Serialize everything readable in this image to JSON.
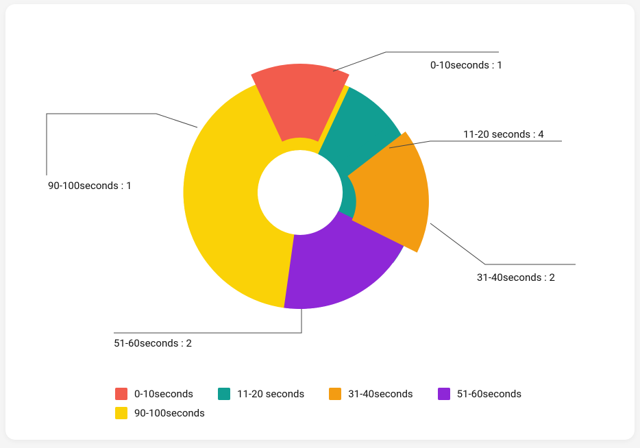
{
  "chart_data": {
    "type": "pie",
    "title": "",
    "inner_radius": 0.35,
    "series": [
      {
        "name": "0-10seconds",
        "value": 1,
        "color": "#F25C4D",
        "exploded": true
      },
      {
        "name": "11-20 seconds",
        "value": 4,
        "color": "#119E92",
        "exploded": false
      },
      {
        "name": "31-40seconds",
        "value": 2,
        "color": "#F39C12",
        "exploded": true
      },
      {
        "name": "51-60seconds",
        "value": 2,
        "color": "#8E27D7",
        "exploded": false
      },
      {
        "name": "90-100seconds",
        "value": 1,
        "color": "#FAD207",
        "exploded": false
      }
    ],
    "label_separator": " : "
  },
  "legend": {
    "items": [
      {
        "label": "0-10seconds",
        "color": "#F25C4D"
      },
      {
        "label": "11-20 seconds",
        "color": "#119E92"
      },
      {
        "label": "31-40seconds",
        "color": "#F39C12"
      },
      {
        "label": "51-60seconds",
        "color": "#8E27D7"
      },
      {
        "label": "90-100seconds",
        "color": "#FAD207"
      }
    ]
  },
  "callouts": [
    {
      "key": "s0",
      "label": "0-10seconds",
      "value": "1"
    },
    {
      "key": "s1",
      "label": "11-20 seconds",
      "value": "4"
    },
    {
      "key": "s2",
      "label": "31-40seconds",
      "value": "2"
    },
    {
      "key": "s3",
      "label": "51-60seconds",
      "value": "2"
    },
    {
      "key": "s4",
      "label": "90-100seconds",
      "value": "1"
    }
  ]
}
